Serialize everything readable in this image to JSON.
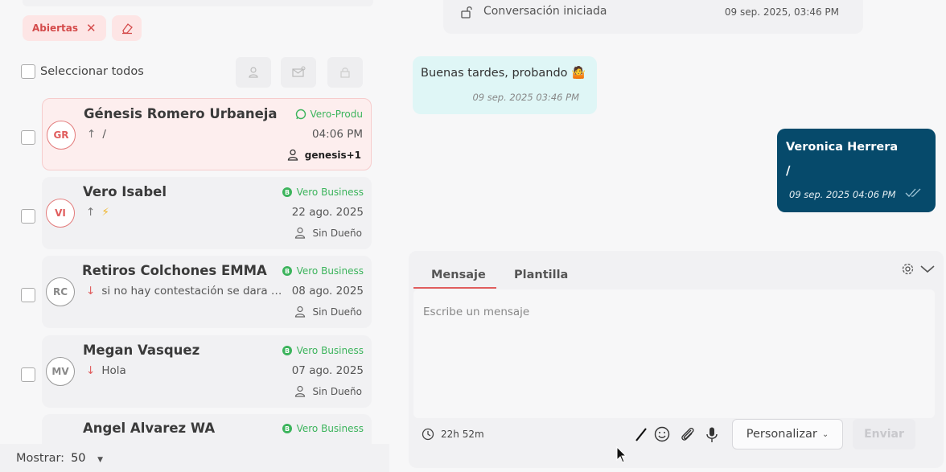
{
  "filters": {
    "active_chip": "Abiertas"
  },
  "list": {
    "select_all_label": "Seleccionar todos",
    "conversations": [
      {
        "initials": "GR",
        "name": "Génesis Romero Urbaneja",
        "channel": "Vero-Produ",
        "direction": "↑",
        "preview": "/",
        "date": "04:06 PM",
        "owner": "genesis+1"
      },
      {
        "initials": "VI",
        "name": "Vero Isabel",
        "channel": "Vero Business",
        "direction": "↑",
        "preview": "⚡",
        "date": "22 ago. 2025",
        "owner": "Sin Dueño"
      },
      {
        "initials": "RC",
        "name": "Retiros Colchones EMMA",
        "channel": "Vero Business",
        "direction": "↓",
        "preview": "si no hay contestación se dara d...",
        "date": "08 ago. 2025",
        "owner": "Sin Dueño"
      },
      {
        "initials": "MV",
        "name": "Megan Vasquez",
        "channel": "Vero Business",
        "direction": "↓",
        "preview": "Hola",
        "date": "07 ago. 2025",
        "owner": "Sin Dueño"
      },
      {
        "initials": "",
        "name": "Angel Alvarez WA",
        "channel": "Vero Business",
        "direction": "",
        "preview": "",
        "date": "",
        "owner": ""
      }
    ]
  },
  "footer": {
    "show_label": "Mostrar:",
    "show_value": "50"
  },
  "chat": {
    "system_message": "Conversación iniciada",
    "system_time": "09 sep. 2025, 03:46 PM",
    "incoming": {
      "text": "Buenas tardes, probando 🤷",
      "time": "09 sep. 2025 03:46 PM"
    },
    "outgoing": {
      "sender": "Veronica Herrera",
      "text": "/",
      "time": "09 sep. 2025 04:06 PM"
    }
  },
  "composer": {
    "tab_message": "Mensaje",
    "tab_template": "Plantilla",
    "placeholder": "Escribe un mensaje",
    "timer": "22h 52m",
    "customize_label": "Personalizar",
    "send_label": "Enviar"
  },
  "colors": {
    "accent_red": "#e05d5d",
    "whatsapp_green": "#3cb45c",
    "outgoing_bubble": "#064a6b",
    "incoming_bubble": "#dff6f6"
  }
}
